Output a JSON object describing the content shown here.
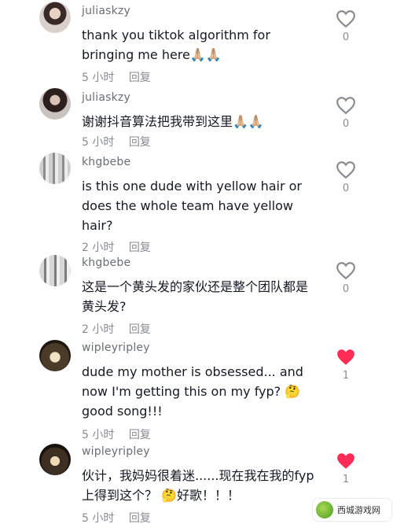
{
  "comments": [
    {
      "username": "juliaskzy",
      "text": "thank you tiktok algorithm for bringing me here🙏🏼🙏🏼",
      "time": "5 小时",
      "reply": "回复",
      "likes": "0",
      "liked": false
    },
    {
      "username": "juliaskzy",
      "text": "谢谢抖音算法把我带到这里🙏🏼🙏🏼",
      "time": "5 小时",
      "reply": "回复",
      "likes": "0",
      "liked": false
    },
    {
      "username": "khgbebe",
      "text": "is this one dude with yellow hair or does the whole team have yellow hair?",
      "time": "2 小时",
      "reply": "回复",
      "likes": "0",
      "liked": false
    },
    {
      "username": "khgbebe",
      "text": "这是一个黄头发的家伙还是整个团队都是黄头发?",
      "time": "2 小时",
      "reply": "回复",
      "likes": "0",
      "liked": false
    },
    {
      "username": "wipleyripley",
      "text": "dude my mother is obsessed... and now I'm getting this on my fyp? 🤔 good song!!!",
      "time": "5 小时",
      "reply": "回复",
      "likes": "1",
      "liked": true
    },
    {
      "username": "wipleyripley",
      "text": "伙计，我妈妈很着迷......现在我在我的fyp上得到这个？ 🤔好歌！！！",
      "time": "5 小时",
      "reply": "回复",
      "likes": "1",
      "liked": true
    }
  ],
  "colors": {
    "liked_heart": "#fe2c55",
    "unliked_heart": "#8a8b91"
  },
  "watermark": {
    "text": "西城游戏网"
  }
}
